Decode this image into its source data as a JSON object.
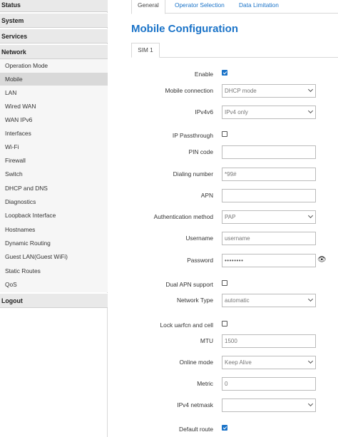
{
  "sidebar": {
    "sections": {
      "status": "Status",
      "system": "System",
      "services": "Services",
      "network": "Network",
      "logout": "Logout"
    },
    "network_items": [
      {
        "label": "Operation Mode"
      },
      {
        "label": "Mobile"
      },
      {
        "label": "LAN"
      },
      {
        "label": "Wired WAN"
      },
      {
        "label": "WAN IPv6"
      },
      {
        "label": "Interfaces"
      },
      {
        "label": "Wi-Fi"
      },
      {
        "label": "Firewall"
      },
      {
        "label": "Switch"
      },
      {
        "label": "DHCP and DNS"
      },
      {
        "label": "Diagnostics"
      },
      {
        "label": "Loopback Interface"
      },
      {
        "label": "Hostnames"
      },
      {
        "label": "Dynamic Routing"
      },
      {
        "label": "Guest LAN(Guest WiFi)"
      },
      {
        "label": "Static Routes"
      },
      {
        "label": "QoS"
      }
    ],
    "active_item": "Mobile"
  },
  "tabs": [
    "General",
    "Operator Selection",
    "Data Limitation"
  ],
  "active_tab": "General",
  "page_title": "Mobile Configuration",
  "sim_tab": "SIM 1",
  "form": {
    "enable": {
      "label": "Enable",
      "checked": true
    },
    "mobile_connection": {
      "label": "Mobile connection",
      "value": "DHCP mode"
    },
    "ipv4v6": {
      "label": "IPv4v6",
      "value": "IPv4 only"
    },
    "ip_passthrough": {
      "label": "IP Passthrough",
      "checked": false
    },
    "pin_code": {
      "label": "PIN code",
      "value": ""
    },
    "dialing_number": {
      "label": "Dialing number",
      "value": "*99#"
    },
    "apn": {
      "label": "APN",
      "value": ""
    },
    "auth_method": {
      "label": "Authentication method",
      "value": "PAP"
    },
    "username": {
      "label": "Username",
      "placeholder": "username"
    },
    "password": {
      "label": "Password",
      "value": "••••••••"
    },
    "dual_apn": {
      "label": "Dual APN support",
      "checked": false
    },
    "network_type": {
      "label": "Network Type",
      "value": "automatic"
    },
    "lock_uarfcn": {
      "label": "Lock uarfcn and cell",
      "checked": false
    },
    "mtu": {
      "label": "MTU",
      "placeholder": "1500"
    },
    "online_mode": {
      "label": "Online mode",
      "value": "Keep Alive"
    },
    "metric": {
      "label": "Metric",
      "placeholder": "0"
    },
    "ipv4_netmask": {
      "label": "IPv4 netmask",
      "value": ""
    },
    "default_route": {
      "label": "Default route",
      "checked": true
    }
  },
  "colors": {
    "accent": "#1a73c8",
    "section_bg": "#e9e9e9",
    "active_item_bg": "#d9d9d9"
  }
}
